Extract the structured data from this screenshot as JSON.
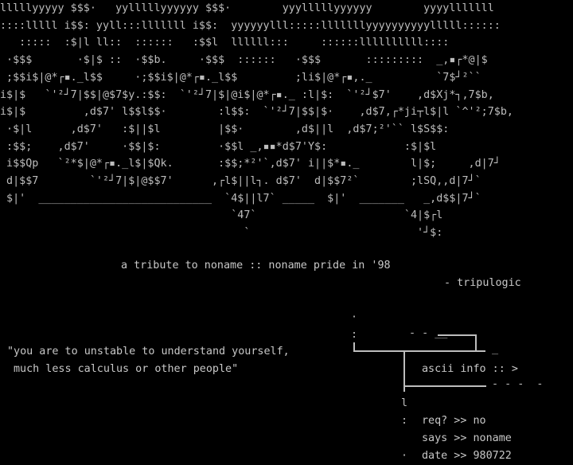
{
  "logo_art_lines": [
    "lllllyyyyy $$$·   yylllllyyyyyy $$$·        yyylllllyyyyyy        yyyylllllll",
    "::::lllll i$$: yyll:::lllllll i$$:  yyyyyylll:::::lllllllyyyyyyyyyylllll::::::",
    "   :::::  :$|l ll::  ::::::   :$$l  llllll:::     ::::::llllllllll::::",
    " ·$$$       ·$|$ ::  ·$$b.     ·$$$  ::::::   ·$$$       :::::::::  _,▪┌*@|$",
    " ;$$i$|@*┌▪._l$$     ·;$$i$|@*┌▪._l$$         ;li$|@*┌▪,._          `7$┘²``",
    "i$|$   `'²┘7|$$|@$7$y.:$$:  `'²┘7|$|@i$|@*┌▪._ :l|$:  `'²┘$7'    ,d$Xj*┐,7$b,",
    "i$|$         ,d$7' l$$l$$·        :l$$:  `'²┘7|$$|$·    ,d$7,┌*ji┬l$|l `^'²;7$b,",
    " ·$|l      ,d$7'   :$||$l         |$$·        ,d$||l  ,d$7;²'`` l$S$$:",
    " :$$;    ,d$7'     ·$$|$:         ·$$l _,▪▪*d$7'Y$:            :$|$l",
    " i$$Qp   `²*$|@*┌▪._l$|$Qk.       :$$;*²'`,d$7' i||$*▪._        l|$;     ,d|7┘",
    " d|$$7        `'²┘7|$|@$$7'      ,┌l$||l┐. d$7'  d|$$7²`        ;lSQ,,d|7┘`",
    " $|'  ___________________________  `4$||l7` _____  $|'  _______   _,d$$|7┘`",
    "                                    `47`                       `4|$┌l",
    "                                      `                          '┘$:"
  ],
  "tribute_text": "a tribute to noname :: noname pride in '98",
  "author_text": "- tripulogic",
  "quote_line_1": "\"you are to unstable to understand yourself,",
  "quote_line_2": "much less calculus or other people\"",
  "info_box": {
    "title": "ascii info :: >",
    "req": "req? >> no",
    "says": "says >> noname",
    "date": "date >> 980722"
  },
  "colors": {
    "background": "#000000",
    "text": "#c8c8c8"
  }
}
